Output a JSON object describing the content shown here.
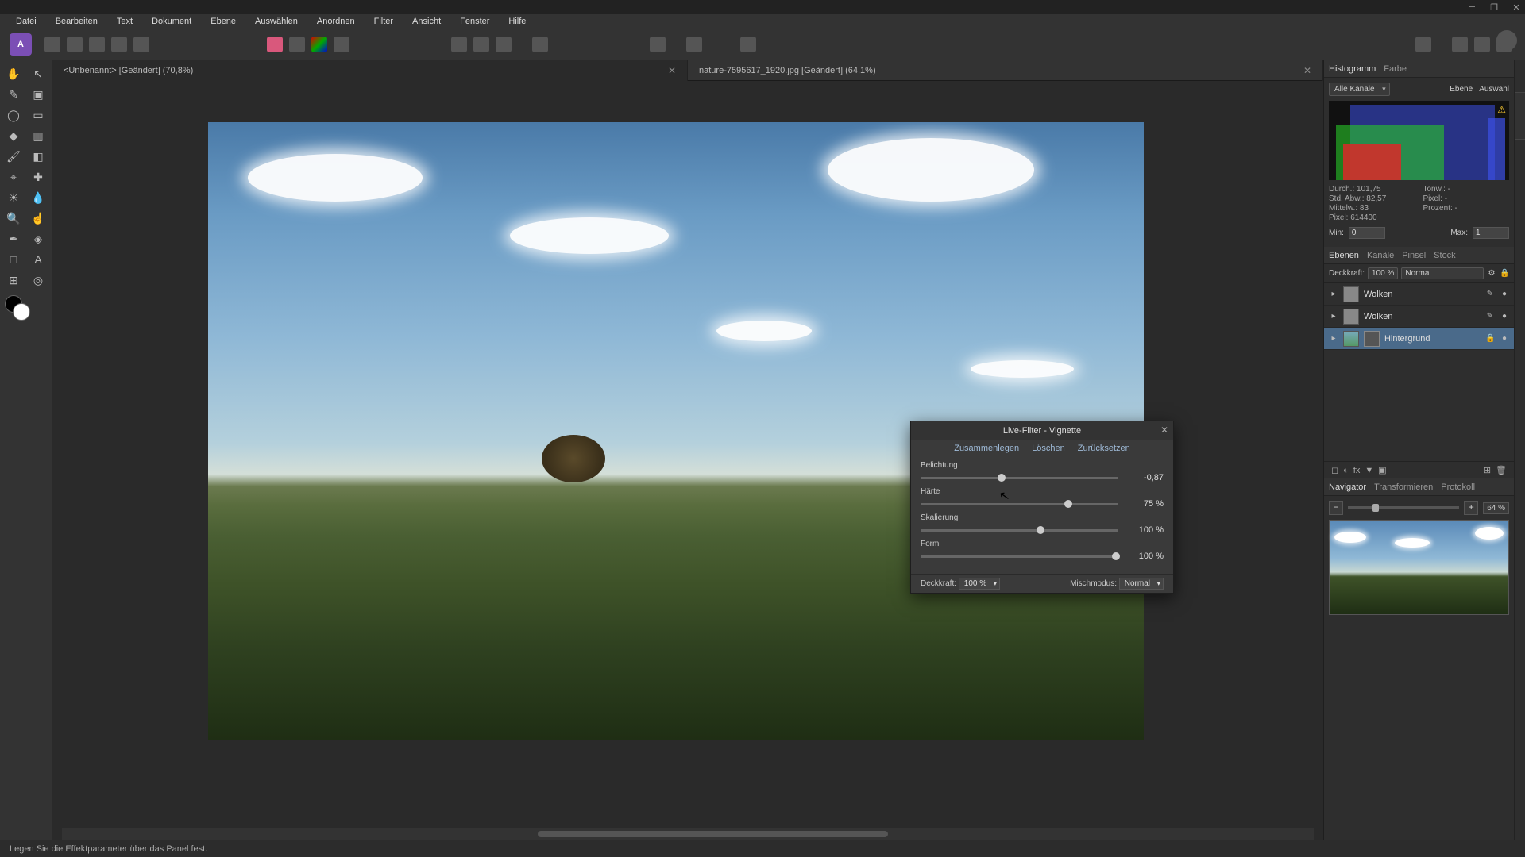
{
  "window": {
    "minimize": "─",
    "maximize": "❐",
    "close": "✕"
  },
  "menu": [
    "Datei",
    "Bearbeiten",
    "Text",
    "Dokument",
    "Ebene",
    "Auswählen",
    "Anordnen",
    "Filter",
    "Ansicht",
    "Fenster",
    "Hilfe"
  ],
  "tabs": [
    {
      "label": "<Unbenannt> [Geändert] (70,8%)",
      "active": true
    },
    {
      "label": "nature-7595617_1920.jpg [Geändert] (64,1%)",
      "active": false
    }
  ],
  "rightTabs1": [
    "Histogramm",
    "Farbe"
  ],
  "histogram": {
    "channelLabel": "Alle Kanäle",
    "ebene": "Ebene",
    "auswahl": "Auswahl",
    "stats": {
      "mean": "Durch.: 101,75",
      "tones": "Tonw.: -",
      "stddev": "Std. Abw.: 82,57",
      "pixel": "Pixel: -",
      "median": "Mittelw.: 83",
      "percent": "Prozent: -",
      "count": "Pixel: 614400"
    },
    "minLabel": "Min:",
    "minVal": "0",
    "maxLabel": "Max:",
    "maxVal": "1"
  },
  "layerTabs": [
    "Ebenen",
    "Kanäle",
    "Pinsel",
    "Stock"
  ],
  "layerHeader": {
    "opacity": "Deckkraft:",
    "opacityVal": "100 %",
    "blend": "Normal"
  },
  "layers": [
    {
      "name": "Wolken",
      "sel": false
    },
    {
      "name": "Wolken",
      "sel": false
    },
    {
      "name": "Hintergrund",
      "sel": true,
      "mask": true
    }
  ],
  "navTabs": [
    "Navigator",
    "Transformieren",
    "Protokoll"
  ],
  "navigator": {
    "zoom": "64 %"
  },
  "status": "Legen Sie die Effektparameter über das Panel fest.",
  "dialog": {
    "title": "Live-Filter - Vignette",
    "actions": [
      "Zusammenlegen",
      "Löschen",
      "Zurücksetzen"
    ],
    "params": [
      {
        "label": "Belichtung",
        "value": "-0,87",
        "pos": 39
      },
      {
        "label": "Härte",
        "value": "75 %",
        "pos": 73
      },
      {
        "label": "Skalierung",
        "value": "100 %",
        "pos": 59
      },
      {
        "label": "Form",
        "value": "100 %",
        "pos": 97
      }
    ],
    "opacityLabel": "Deckkraft:",
    "opacityVal": "100 %",
    "blendLabel": "Mischmodus:",
    "blendVal": "Normal"
  }
}
